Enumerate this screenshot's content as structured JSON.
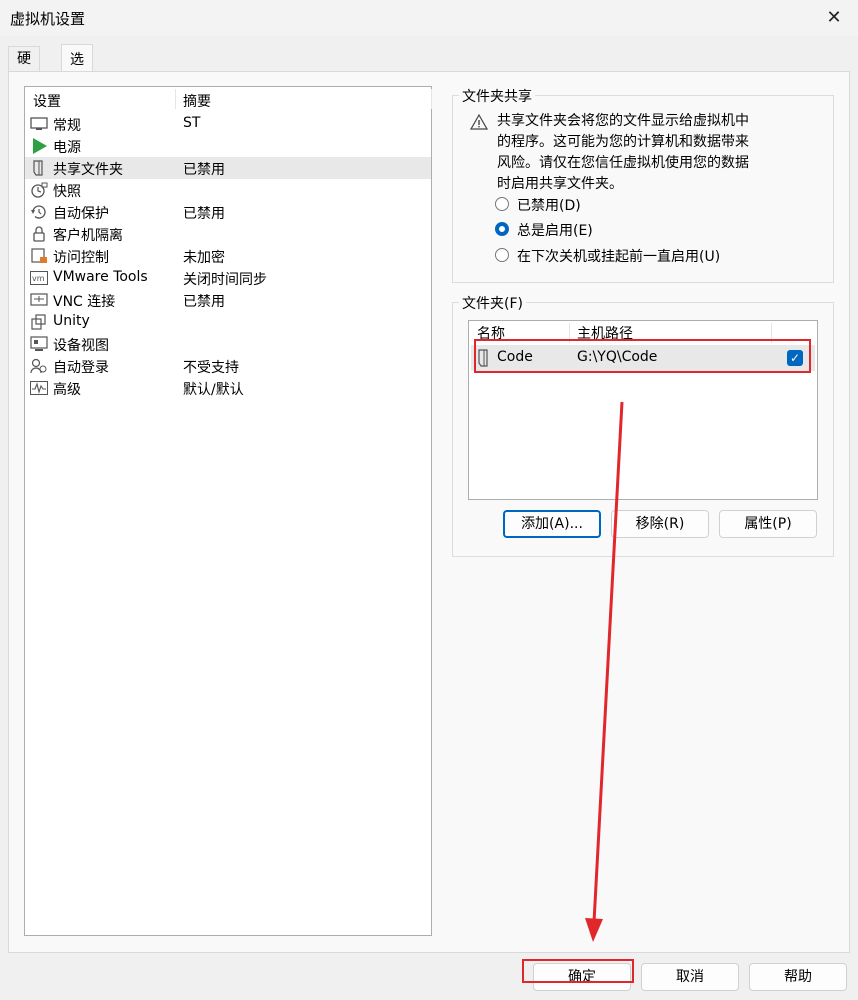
{
  "window": {
    "title": "虚拟机设置"
  },
  "tabs": [
    {
      "label": "硬件"
    },
    {
      "label": "选项"
    }
  ],
  "settings_list": {
    "headers": [
      "设置",
      "摘要"
    ],
    "rows": [
      {
        "name": "常规",
        "summary": "ST",
        "icon": "monitor-icon"
      },
      {
        "name": "电源",
        "summary": "",
        "icon": "power-play-icon"
      },
      {
        "name": "共享文件夹",
        "summary": "已禁用",
        "icon": "shared-folder-icon",
        "selected": true
      },
      {
        "name": "快照",
        "summary": "",
        "icon": "snapshot-icon"
      },
      {
        "name": "自动保护",
        "summary": "已禁用",
        "icon": "autoprotect-icon"
      },
      {
        "name": "客户机隔离",
        "summary": "",
        "icon": "lock-icon"
      },
      {
        "name": "访问控制",
        "summary": "未加密",
        "icon": "access-control-icon"
      },
      {
        "name": "VMware Tools",
        "summary": "关闭时间同步",
        "icon": "vm-icon"
      },
      {
        "name": "VNC 连接",
        "summary": "已禁用",
        "icon": "vnc-icon"
      },
      {
        "name": "Unity",
        "summary": "",
        "icon": "unity-icon"
      },
      {
        "name": "设备视图",
        "summary": "",
        "icon": "device-view-icon"
      },
      {
        "name": "自动登录",
        "summary": "不受支持",
        "icon": "autologin-icon"
      },
      {
        "name": "高级",
        "summary": "默认/默认",
        "icon": "advanced-icon"
      }
    ]
  },
  "folder_sharing": {
    "title": "文件夹共享",
    "warning_lines": [
      "共享文件夹会将您的文件显示给虚拟机中",
      "的程序。这可能为您的计算机和数据带来",
      "风险。请仅在您信任虚拟机使用您的数据",
      "时启用共享文件夹。"
    ],
    "options": [
      {
        "label": "已禁用(D)",
        "checked": false
      },
      {
        "label": "总是启用(E)",
        "checked": true
      },
      {
        "label": "在下次关机或挂起前一直启用(U)",
        "checked": false
      }
    ]
  },
  "folders": {
    "title": "文件夹(F)",
    "headers": [
      "名称",
      "主机路径"
    ],
    "rows": [
      {
        "name": "Code",
        "path": "G:\\YQ\\Code",
        "enabled": true
      }
    ],
    "buttons": {
      "add": "添加(A)...",
      "remove": "移除(R)",
      "properties": "属性(P)"
    }
  },
  "footer": {
    "ok": "确定",
    "cancel": "取消",
    "help": "帮助"
  },
  "colors": {
    "accent": "#0067c0",
    "annotation_red": "#e0282c",
    "power_green": "#2ea043"
  }
}
